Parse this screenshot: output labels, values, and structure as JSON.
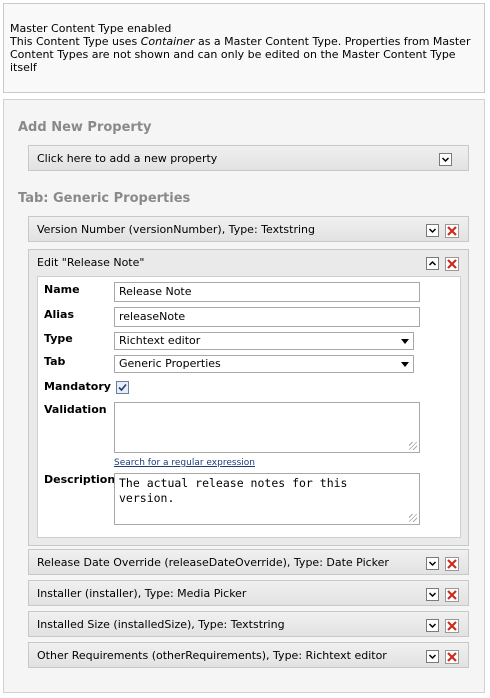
{
  "notice": {
    "title": "Master Content Type enabled",
    "text_before": "This Content Type uses ",
    "master_name": "Container",
    "text_after": " as a Master Content Type. Properties from Master Content Types are not shown and can only be edited on the Master Content Type itself"
  },
  "add_section": {
    "title": "Add New Property",
    "add_bar_label": "Click here to add a new property"
  },
  "tab_section": {
    "title": "Tab: Generic Properties"
  },
  "properties": [
    {
      "label": "Version Number (versionNumber), Type: Textstring"
    },
    {
      "label": "Release Date Override (releaseDateOverride), Type: Date Picker"
    },
    {
      "label": "Installer (installer), Type: Media Picker"
    },
    {
      "label": "Installed Size (installedSize), Type: Textstring"
    },
    {
      "label": "Other Requirements (otherRequirements), Type: Richtext editor"
    }
  ],
  "edit": {
    "title": "Edit \"Release Note\"",
    "fields": {
      "name_label": "Name",
      "name_value": "Release Note",
      "alias_label": "Alias",
      "alias_value": "releaseNote",
      "type_label": "Type",
      "type_value": "Richtext editor",
      "tab_label": "Tab",
      "tab_value": "Generic Properties",
      "mandatory_label": "Mandatory",
      "mandatory_checked": true,
      "validation_label": "Validation",
      "validation_value": "",
      "regex_link": "Search for a regular expression",
      "description_label": "Description",
      "description_value": "The actual release notes for this\nversion."
    }
  },
  "colors": {
    "delete_red": "#cc2b1e",
    "link_blue": "#1a3d7a",
    "section_gray": "#8a8a8a"
  },
  "icons": {
    "expand": "chevron-down-icon",
    "collapse": "chevron-up-icon",
    "delete": "delete-x-icon",
    "check": "checkmark-icon"
  }
}
